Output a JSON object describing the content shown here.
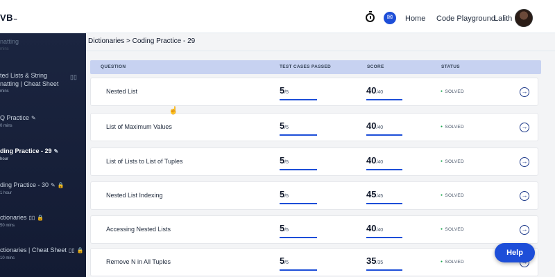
{
  "header": {
    "logo": "VB",
    "nav": {
      "home": "Home",
      "playground": "Code Playground",
      "user": "Lalith"
    }
  },
  "sidebar": {
    "items": [
      {
        "title": "natting",
        "sub": "mins"
      },
      {
        "title": "ted Lists & String",
        "title2": "natting | Cheat Sheet",
        "sub": "mins"
      },
      {
        "title": "Q Practice",
        "sub": "0 mins"
      },
      {
        "title": "ding Practice - 29",
        "sub": "hour"
      },
      {
        "title": "ding Practice - 30",
        "sub": "1 hour"
      },
      {
        "title": "ctionaries",
        "sub": "50 mins"
      },
      {
        "title": "ctionaries | Cheat Sheet",
        "sub": "10 mins"
      }
    ]
  },
  "breadcrumb": "Dictionaries > Coding Practice - 29",
  "table": {
    "headers": {
      "question": "QUESTION",
      "tests": "TEST CASES PASSED",
      "score": "SCORE",
      "status": "STATUS"
    },
    "rows": [
      {
        "question": "Nested List",
        "passed": "5",
        "total": "/5",
        "score": "40",
        "max": "/40",
        "status": "SOLVED"
      },
      {
        "question": "List of Maximum Values",
        "passed": "5",
        "total": "/5",
        "score": "40",
        "max": "/40",
        "status": "SOLVED"
      },
      {
        "question": "List of Lists to List of Tuples",
        "passed": "5",
        "total": "/5",
        "score": "40",
        "max": "/40",
        "status": "SOLVED"
      },
      {
        "question": "Nested List Indexing",
        "passed": "5",
        "total": "/5",
        "score": "45",
        "max": "/45",
        "status": "SOLVED"
      },
      {
        "question": "Accessing Nested Lists",
        "passed": "5",
        "total": "/5",
        "score": "40",
        "max": "/40",
        "status": "SOLVED"
      },
      {
        "question": "Remove N in All Tuples",
        "passed": "5",
        "total": "/5",
        "score": "35",
        "max": "/35",
        "status": "SOLVED"
      }
    ]
  },
  "help_label": "Help",
  "icons": {
    "timer": "stopwatch-icon",
    "chat": "chat-icon",
    "arrow": "arrow-right-circle-icon",
    "edit": "pencil-icon",
    "lock": "lock-icon",
    "book": "book-icon"
  },
  "colors": {
    "accent": "#1d4ed8",
    "sidebar": "#1b2540",
    "header_row": "#c7d2f1",
    "solved": "#16a34a"
  }
}
